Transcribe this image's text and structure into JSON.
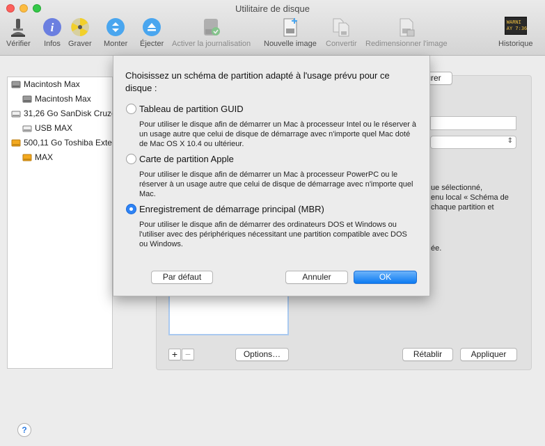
{
  "window": {
    "title": "Utilitaire de disque"
  },
  "toolbar": [
    {
      "id": "verify",
      "label": "Vérifier",
      "icon": "microscope-icon",
      "enabled": true
    },
    {
      "id": "info",
      "label": "Infos",
      "icon": "info-icon",
      "enabled": true
    },
    {
      "id": "burn",
      "label": "Graver",
      "icon": "burn-icon",
      "enabled": true
    },
    {
      "id": "mount",
      "label": "Monter",
      "icon": "mount-icon",
      "enabled": true
    },
    {
      "id": "eject",
      "label": "Éjecter",
      "icon": "eject-icon",
      "enabled": true
    },
    {
      "id": "journal",
      "label": "Activer la journalisation",
      "icon": "journal-icon",
      "enabled": false
    },
    {
      "id": "newimage",
      "label": "Nouvelle image",
      "icon": "new-image-icon",
      "enabled": true
    },
    {
      "id": "convert",
      "label": "Convertir",
      "icon": "convert-icon",
      "enabled": false
    },
    {
      "id": "resize",
      "label": "Redimensionner l'image",
      "icon": "resize-image-icon",
      "enabled": false
    },
    {
      "id": "history",
      "label": "Historique",
      "icon": "log-icon",
      "enabled": true
    }
  ],
  "history_icon_text": "WARNI\nAY 7:36",
  "sidebar": {
    "items": [
      {
        "label": "Macintosh Max",
        "level": 0,
        "icon": "internal-disk-icon"
      },
      {
        "label": "Macintosh Max",
        "level": 1,
        "icon": "internal-volume-icon"
      },
      {
        "label": "31,26 Go SanDisk Cruzer",
        "level": 0,
        "icon": "usb-disk-icon"
      },
      {
        "label": "USB MAX",
        "level": 1,
        "icon": "usb-volume-icon"
      },
      {
        "label": "500,11 Go Toshiba External",
        "level": 0,
        "icon": "external-disk-icon"
      },
      {
        "label": "MAX",
        "level": 1,
        "icon": "external-volume-icon"
      }
    ]
  },
  "background": {
    "partial_button": "urer",
    "text_lines": [
      "ue sélectionné,",
      "enu local « Schéma de",
      "chaque partition et",
      "ée."
    ],
    "plus": "+",
    "minus": "−",
    "options_button": "Options…",
    "revert_button": "Rétablir",
    "apply_button": "Appliquer"
  },
  "sheet": {
    "prompt": "Choisissez un schéma de partition adapté à l'usage prévu pour ce disque :",
    "options": [
      {
        "label": "Tableau de partition GUID",
        "selected": false,
        "description": "Pour utiliser le disque afin de démarrer un Mac à processeur Intel ou le réserver à un usage autre que celui de disque de démarrage avec n'importe quel Mac doté de Mac OS X 10.4 ou ultérieur."
      },
      {
        "label": "Carte de partition Apple",
        "selected": false,
        "description": "Pour utiliser le disque afin de démarrer un Mac à processeur PowerPC ou le réserver à un usage autre que celui de disque de démarrage avec n'importe quel Mac."
      },
      {
        "label": "Enregistrement de démarrage principal (MBR)",
        "selected": true,
        "description": "Pour utiliser le disque afin de démarrer des ordinateurs DOS et Windows ou l'utiliser avec des périphériques nécessitant une partition compatible avec DOS ou Windows."
      }
    ],
    "default_button": "Par défaut",
    "cancel_button": "Annuler",
    "ok_button": "OK"
  },
  "help": {
    "label": "?"
  },
  "colors": {
    "accent": "#2e83f5",
    "ok_button": "#0d7bf2"
  }
}
